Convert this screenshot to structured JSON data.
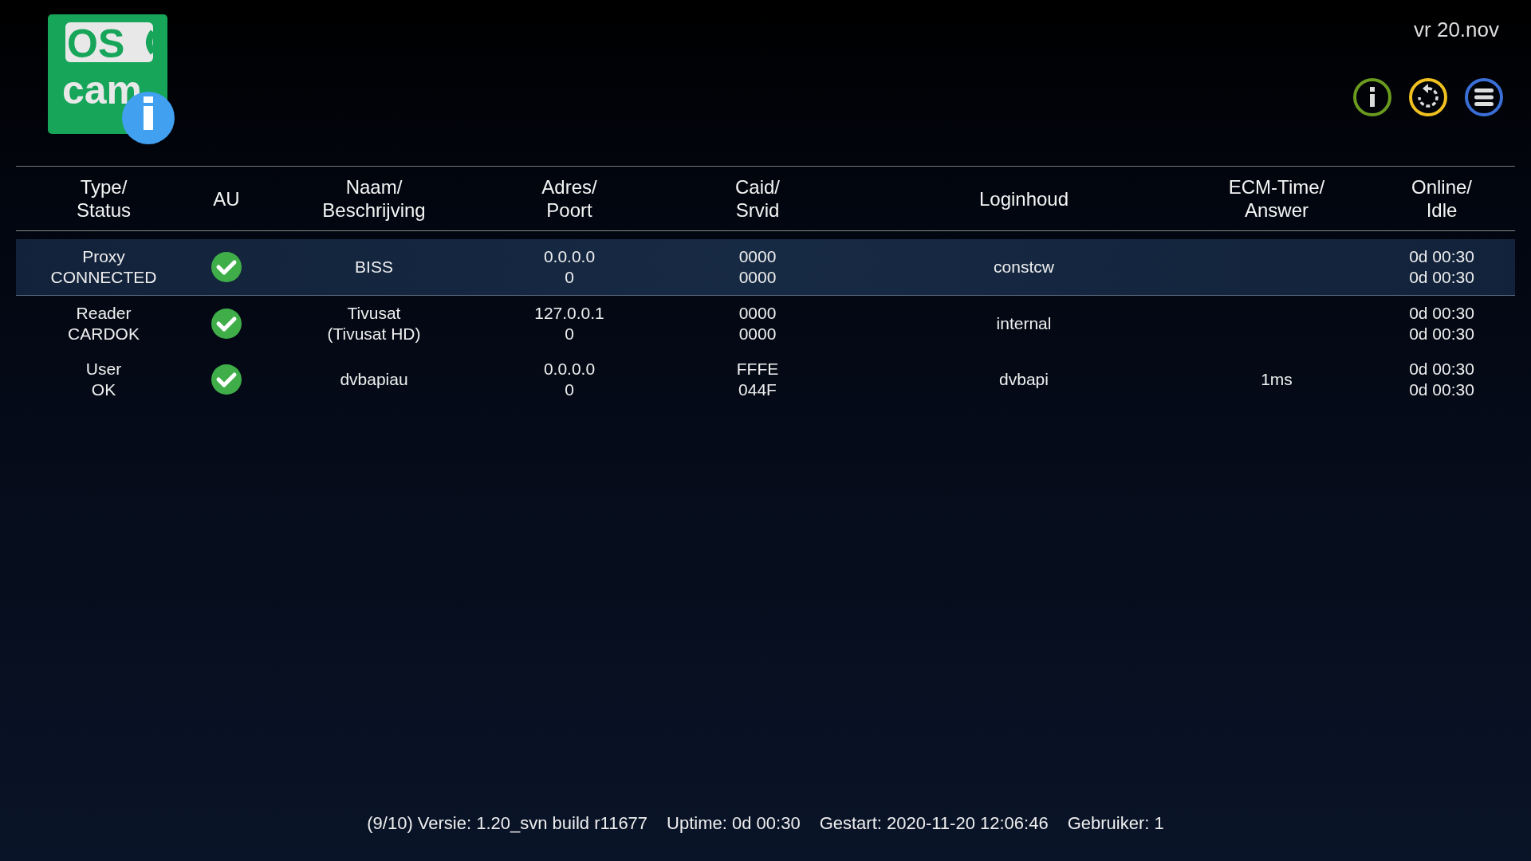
{
  "header": {
    "logo": [
      "OS",
      "cam"
    ],
    "date": "vr 20.nov",
    "toolbar": [
      {
        "kind": "info",
        "color": "#6a9a1e"
      },
      {
        "kind": "restart",
        "color": "#f0c020"
      },
      {
        "kind": "menu",
        "color": "#3a6fd8"
      }
    ]
  },
  "table": {
    "columns": [
      [
        "Type/",
        "Status"
      ],
      [
        "AU"
      ],
      [
        "Naam/",
        "Beschrijving"
      ],
      [
        "Adres/",
        "Poort"
      ],
      [
        "Caid/",
        "Srvid"
      ],
      [
        "Loginhoud"
      ],
      [
        "ECM-Time/",
        "Answer"
      ],
      [
        "Online/",
        "Idle"
      ]
    ],
    "rows": [
      {
        "selected": true,
        "au": true,
        "type_status": [
          "Proxy",
          "CONNECTED"
        ],
        "name": [
          "BISS"
        ],
        "address": [
          "0.0.0.0",
          "0"
        ],
        "caid_srvid": [
          "0000",
          "0000"
        ],
        "login": [
          "constcw"
        ],
        "online_idle": [
          "0d 00:30",
          "0d 00:30"
        ]
      },
      {
        "selected": false,
        "au": true,
        "type_status": [
          "Reader",
          "CARDOK"
        ],
        "name": [
          "Tivusat",
          "(Tivusat HD)"
        ],
        "address": [
          "127.0.0.1",
          "0"
        ],
        "caid_srvid": [
          "0000",
          "0000"
        ],
        "login": [
          "internal"
        ],
        "online_idle": [
          "0d 00:30",
          "0d 00:30"
        ]
      },
      {
        "selected": false,
        "au": true,
        "type_status": [
          "User",
          "OK"
        ],
        "name": [
          "dvbapiau"
        ],
        "address": [
          "0.0.0.0",
          "0"
        ],
        "caid_srvid": [
          "FFFE",
          "044F"
        ],
        "login": [
          "dvbapi"
        ],
        "ecm_time": [
          "1ms"
        ],
        "online_idle": [
          "0d 00:30",
          "0d 00:30"
        ]
      }
    ]
  },
  "status_bar": [
    "(9/10) Versie: 1.20_svn build r11677",
    "Uptime: 0d 00:30",
    "Gestart: 2020-11-20 12:06:46",
    "Gebruiker: 1"
  ]
}
